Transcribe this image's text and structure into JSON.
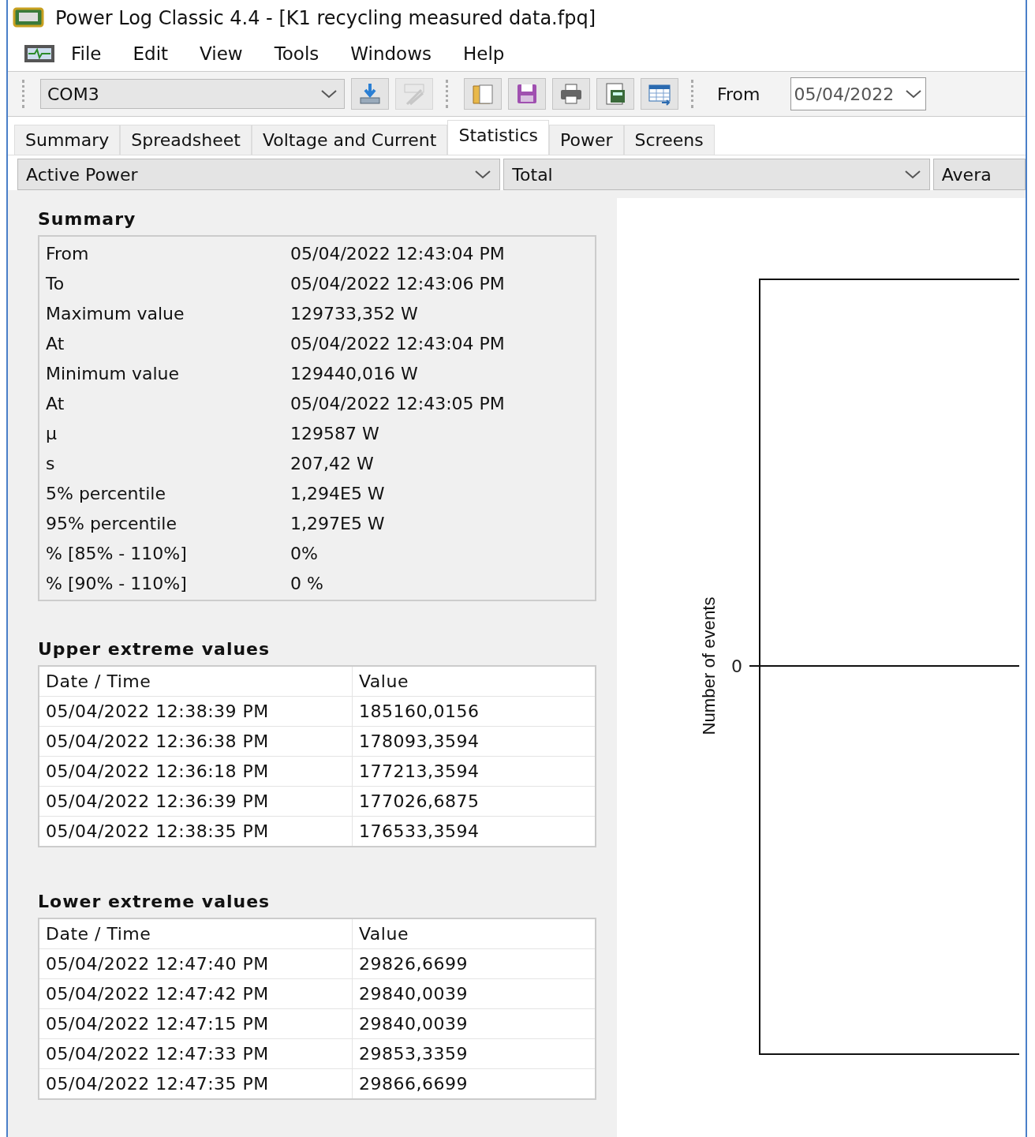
{
  "window": {
    "title": "Power Log Classic 4.4 - [K1 recycling measured data.fpq]"
  },
  "menu": [
    "File",
    "Edit",
    "View",
    "Tools",
    "Windows",
    "Help"
  ],
  "toolbar": {
    "port": "COM3",
    "buttons": [
      {
        "kind": "download",
        "disabled": false
      },
      {
        "kind": "meter",
        "disabled": true
      }
    ],
    "file_buttons": [
      {
        "kind": "open",
        "disabled": false
      },
      {
        "kind": "save",
        "disabled": false
      },
      {
        "kind": "print",
        "disabled": false
      },
      {
        "kind": "export",
        "disabled": false
      },
      {
        "kind": "table",
        "disabled": false
      }
    ],
    "from_label": "From",
    "from_value": "05/04/2022"
  },
  "tabs": [
    {
      "label": "Summary",
      "selected": false
    },
    {
      "label": "Spreadsheet",
      "selected": false
    },
    {
      "label": "Voltage and Current",
      "selected": false
    },
    {
      "label": "Statistics",
      "selected": true
    },
    {
      "label": "Power",
      "selected": false
    },
    {
      "label": "Screens",
      "selected": false
    }
  ],
  "selectors": [
    {
      "value": "Active Power"
    },
    {
      "value": "Total"
    },
    {
      "value": "Avera"
    }
  ],
  "summary": {
    "title": "Summary",
    "rows": [
      {
        "label": "From",
        "value": "05/04/2022 12:43:04 PM"
      },
      {
        "label": "To",
        "value": "05/04/2022 12:43:06 PM"
      },
      {
        "label": "Maximum value",
        "value": "129733,352  W"
      },
      {
        "label": "At",
        "value": "05/04/2022 12:43:04 PM"
      },
      {
        "label": "Minimum value",
        "value": "129440,016  W"
      },
      {
        "label": "At",
        "value": "05/04/2022 12:43:05 PM"
      },
      {
        "label": "µ",
        "value": "129587 W"
      },
      {
        "label": "s",
        "value": "207,42 W"
      },
      {
        "label": "5% percentile",
        "value": "1,294E5 W"
      },
      {
        "label": "95% percentile",
        "value": "1,297E5 W"
      },
      {
        "label": "% [85% - 110%]",
        "value": "0%"
      },
      {
        "label": "% [90% - 110%]",
        "value": "0 %"
      }
    ]
  },
  "upper_extremes": {
    "title": "Upper extreme values",
    "columns": [
      "Date / Time",
      "Value"
    ],
    "rows": [
      [
        "05/04/2022 12:38:39 PM",
        "185160,0156"
      ],
      [
        "05/04/2022 12:36:38 PM",
        "178093,3594"
      ],
      [
        "05/04/2022 12:36:18 PM",
        "177213,3594"
      ],
      [
        "05/04/2022 12:36:39 PM",
        "177026,6875"
      ],
      [
        "05/04/2022 12:38:35 PM",
        "176533,3594"
      ]
    ]
  },
  "lower_extremes": {
    "title": "Lower extreme values",
    "columns": [
      "Date / Time",
      "Value"
    ],
    "rows": [
      [
        "05/04/2022 12:47:40 PM",
        "29826,6699"
      ],
      [
        "05/04/2022 12:47:42 PM",
        "29840,0039"
      ],
      [
        "05/04/2022 12:47:15 PM",
        "29840,0039"
      ],
      [
        "05/04/2022 12:47:33 PM",
        "29853,3359"
      ],
      [
        "05/04/2022 12:47:35 PM",
        "29866,6699"
      ]
    ]
  },
  "chart": {
    "ylabel": "Number of events",
    "ytick": "0"
  }
}
